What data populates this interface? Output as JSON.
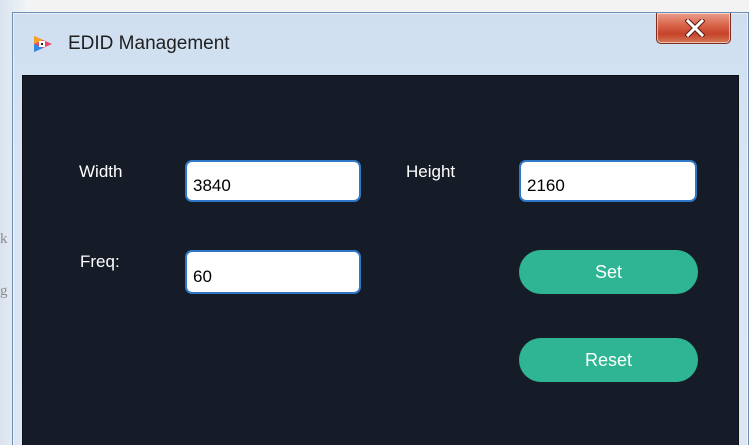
{
  "window": {
    "title": "EDID Management",
    "close_icon": "close-x-icon",
    "app_icon": "app-logo-icon"
  },
  "background": {
    "fragment_a": "k",
    "fragment_b": "g"
  },
  "form": {
    "width_label": "Width",
    "width_value": "3840",
    "height_label": "Height",
    "height_value": "2160",
    "freq_label": "Freq:",
    "freq_value": "60"
  },
  "buttons": {
    "set_label": "Set",
    "reset_label": "Reset"
  },
  "colors": {
    "panel_background": "#161c27",
    "button_accent": "#2fb593",
    "field_border": "#2f78c8",
    "close_button": "#c6432a"
  }
}
